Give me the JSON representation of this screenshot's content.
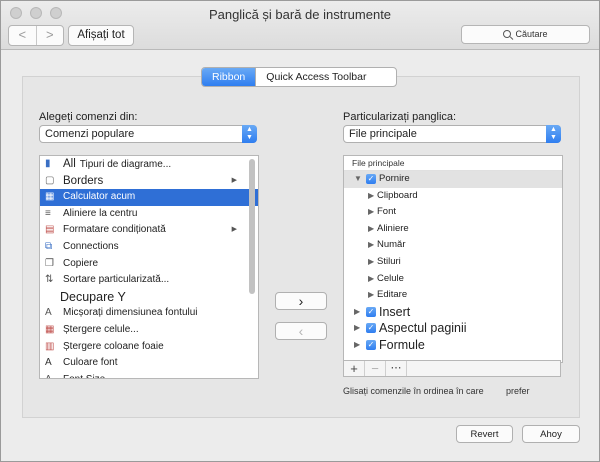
{
  "window": {
    "title": "Panglică și bară de instrumente"
  },
  "toolbar": {
    "back": "<",
    "forward": ">",
    "show_all": "Afișați tot",
    "search_placeholder": "Căutare"
  },
  "tabs": [
    {
      "label": "Ribbon",
      "active": true
    },
    {
      "label": "Quick Access Toolbar",
      "active": false
    }
  ],
  "left": {
    "label": "Alegeți comenzi din:",
    "dropdown": "Comenzi populare",
    "items": [
      {
        "label": "All",
        "suffix": "Tipuri de diagrame...",
        "icon": "chart-icon"
      },
      {
        "label": "Borders",
        "icon": "borders-icon",
        "submenu": true
      },
      {
        "label": "Calculator acum",
        "icon": "calculator-icon",
        "selected": true
      },
      {
        "label": "Aliniere la centru",
        "icon": "align-center-icon"
      },
      {
        "label": "Formatare condiționată",
        "icon": "conditional-format-icon",
        "submenu": true
      },
      {
        "label": "Connections",
        "icon": "connections-icon"
      },
      {
        "label": "Copiere",
        "icon": "copy-icon"
      },
      {
        "label": "Sortare particularizată...",
        "icon": "sort-icon"
      },
      {
        "label": "Decupare Y",
        "icon": "",
        "big": true
      },
      {
        "label": "Micșorați dimensiunea fontului",
        "icon": "decrease-font-icon"
      },
      {
        "label": "Ștergere celule...",
        "icon": "delete-cells-icon"
      },
      {
        "label": "Ștergere coloane foaie",
        "icon": "delete-columns-icon"
      },
      {
        "label": "Culoare font",
        "icon": "font-color-icon"
      },
      {
        "label": "Font Size",
        "icon": "font-size-icon"
      }
    ]
  },
  "middle": {
    "add": "›",
    "remove": "‹"
  },
  "right": {
    "label": "Particularizați panglica:",
    "dropdown": "File principale",
    "tree_header": "File principale",
    "items": [
      {
        "label": "Pornire",
        "level": 0,
        "checked": true,
        "expanded": true
      },
      {
        "label": "Clipboard",
        "level": 1
      },
      {
        "label": "Font",
        "level": 1
      },
      {
        "label": "Aliniere",
        "level": 1
      },
      {
        "label": "Număr",
        "level": 1
      },
      {
        "label": "Stiluri",
        "level": 1
      },
      {
        "label": "Celule",
        "level": 1
      },
      {
        "label": "Editare",
        "level": 1
      },
      {
        "label": "Insert",
        "level": 0,
        "checked": true,
        "big": true
      },
      {
        "label": "Aspectul paginii",
        "level": 0,
        "checked": true,
        "big": true
      },
      {
        "label": "Formule",
        "level": 0,
        "checked": true,
        "big": true
      }
    ],
    "footer": {
      "add": "+",
      "remove": "−",
      "more": "⋯"
    },
    "hint": "Glisați comenzile în ordinea în care",
    "hint2": "prefer"
  },
  "buttons": {
    "revert": "Revert",
    "ok": "Ahoy"
  }
}
